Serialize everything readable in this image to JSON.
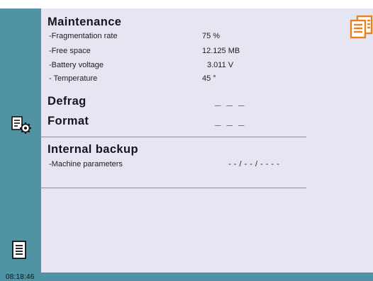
{
  "clock": "08:18:46",
  "maintenance": {
    "title": "Maintenance",
    "rows": [
      {
        "label": "-Fragmentation rate",
        "value": "75 %"
      },
      {
        "label": "-Free space",
        "value": "12.125 MB"
      },
      {
        "label": "-Battery voltage",
        "value": "3.011 V"
      },
      {
        "label": "- Temperature",
        "value": "45 °"
      }
    ]
  },
  "defrag": {
    "label": "Defrag",
    "value": "_ _ _"
  },
  "format": {
    "label": "Format",
    "value": "_ _ _"
  },
  "backup": {
    "title": "Internal backup",
    "rows": [
      {
        "label": "-Machine parameters",
        "value": "- - / - - / - - - -"
      }
    ]
  },
  "icons": {
    "sidebar_settings": "document-gear-icon",
    "sidebar_document": "document-icon",
    "top_right": "documents-stack-icon"
  },
  "colors": {
    "sidebar": "#4f93a5",
    "panel": "#e6e6f2",
    "accent_orange": "#e8821e"
  }
}
